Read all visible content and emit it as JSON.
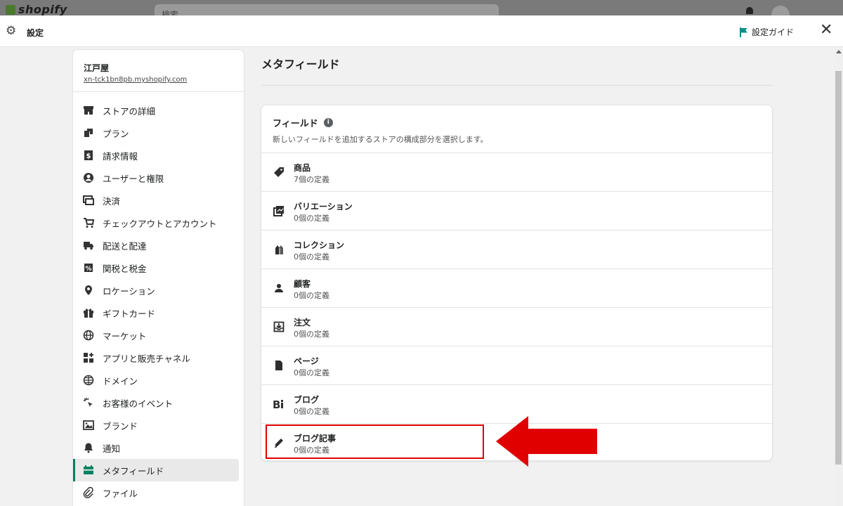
{
  "topbar": {
    "logo": "shopify",
    "search_placeholder": "検索"
  },
  "header": {
    "title": "設定",
    "guide_label": "設定ガイド",
    "close_glyph": "✕"
  },
  "store": {
    "name": "江戸屋",
    "url": "xn-tck1bn8pb.myshopify.com"
  },
  "sidebar": {
    "items": [
      {
        "label": "ストアの詳細",
        "icon": "store-icon"
      },
      {
        "label": "プラン",
        "icon": "plan-icon"
      },
      {
        "label": "請求情報",
        "icon": "billing-icon"
      },
      {
        "label": "ユーザーと権限",
        "icon": "user-icon"
      },
      {
        "label": "決済",
        "icon": "payment-icon"
      },
      {
        "label": "チェックアウトとアカウント",
        "icon": "cart-icon"
      },
      {
        "label": "配送と配達",
        "icon": "truck-icon"
      },
      {
        "label": "関税と税金",
        "icon": "tax-icon"
      },
      {
        "label": "ロケーション",
        "icon": "location-pin-icon"
      },
      {
        "label": "ギフトカード",
        "icon": "gift-icon"
      },
      {
        "label": "マーケット",
        "icon": "globe-icon"
      },
      {
        "label": "アプリと販売チャネル",
        "icon": "apps-icon"
      },
      {
        "label": "ドメイン",
        "icon": "domain-globe-icon"
      },
      {
        "label": "お客様のイベント",
        "icon": "sparkle-cursor-icon"
      },
      {
        "label": "ブランド",
        "icon": "brand-icon"
      },
      {
        "label": "通知",
        "icon": "bell-icon"
      },
      {
        "label": "メタフィールド",
        "icon": "metafield-icon",
        "active": true
      },
      {
        "label": "ファイル",
        "icon": "paperclip-icon"
      }
    ]
  },
  "main": {
    "title": "メタフィールド",
    "card": {
      "title": "フィールド",
      "subtitle": "新しいフィールドを追加するストアの構成部分を選択します。",
      "rows": [
        {
          "name": "商品",
          "count": "7個の定義",
          "icon": "tag-icon"
        },
        {
          "name": "バリエーション",
          "count": "0個の定義",
          "icon": "variants-icon"
        },
        {
          "name": "コレクション",
          "count": "0個の定義",
          "icon": "collection-icon"
        },
        {
          "name": "顧客",
          "count": "0個の定義",
          "icon": "customer-icon"
        },
        {
          "name": "注文",
          "count": "0個の定義",
          "icon": "order-icon"
        },
        {
          "name": "ページ",
          "count": "0個の定義",
          "icon": "page-icon"
        },
        {
          "name": "ブログ",
          "count": "0個の定義",
          "icon": "blog-icon"
        },
        {
          "name": "ブログ記事",
          "count": "0個の定義",
          "icon": "pencil-icon"
        }
      ]
    }
  },
  "colors": {
    "accent_green": "#008060",
    "guide_flag": "#0b8f8a",
    "annotation_red": "#e00000"
  }
}
